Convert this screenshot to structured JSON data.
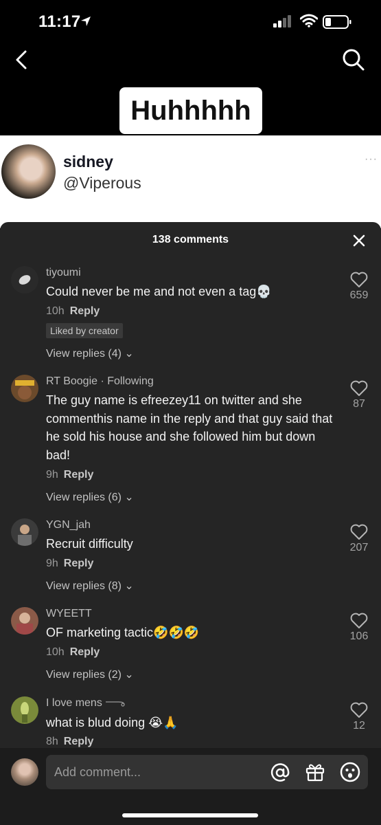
{
  "status_bar": {
    "time": "11:17"
  },
  "header": {
    "title": "Huhhhhh"
  },
  "profile": {
    "name": "sidney",
    "handle": "@Viperous",
    "more": "···"
  },
  "comments_panel": {
    "count_label": "138 comments",
    "comments": [
      {
        "user": "tiyoumi",
        "text": "Could never be me and not even a tag💀",
        "time": "10h",
        "reply_label": "Reply",
        "badge": "Liked by creator",
        "replies_label": "View replies (4) ⌄",
        "likes": "659"
      },
      {
        "user": "RT Boogie",
        "following": "· Following",
        "text": "The guy name is efreezey11 on twitter and she commenthis name in the reply and that guy said that he sold his house and she followed him but down bad!",
        "time": "9h",
        "reply_label": "Reply",
        "replies_label": "View replies (6) ⌄",
        "likes": "87"
      },
      {
        "user": "YGN_jah",
        "text": "Recruit difficulty",
        "time": "9h",
        "reply_label": "Reply",
        "replies_label": "View replies (8) ⌄",
        "likes": "207"
      },
      {
        "user": "WYEETT",
        "text": "OF marketing tactic🤣🤣🤣",
        "time": "10h",
        "reply_label": "Reply",
        "replies_label": "View replies (2) ⌄",
        "likes": "106"
      },
      {
        "user": "I love mens",
        "text": "what is blud doing 😭🙏",
        "time": "8h",
        "reply_label": "Reply",
        "likes": "12"
      }
    ]
  },
  "composer": {
    "placeholder": "Add comment..."
  },
  "colors": {
    "panel_bg": "#252525",
    "accent": "#ffffff"
  }
}
